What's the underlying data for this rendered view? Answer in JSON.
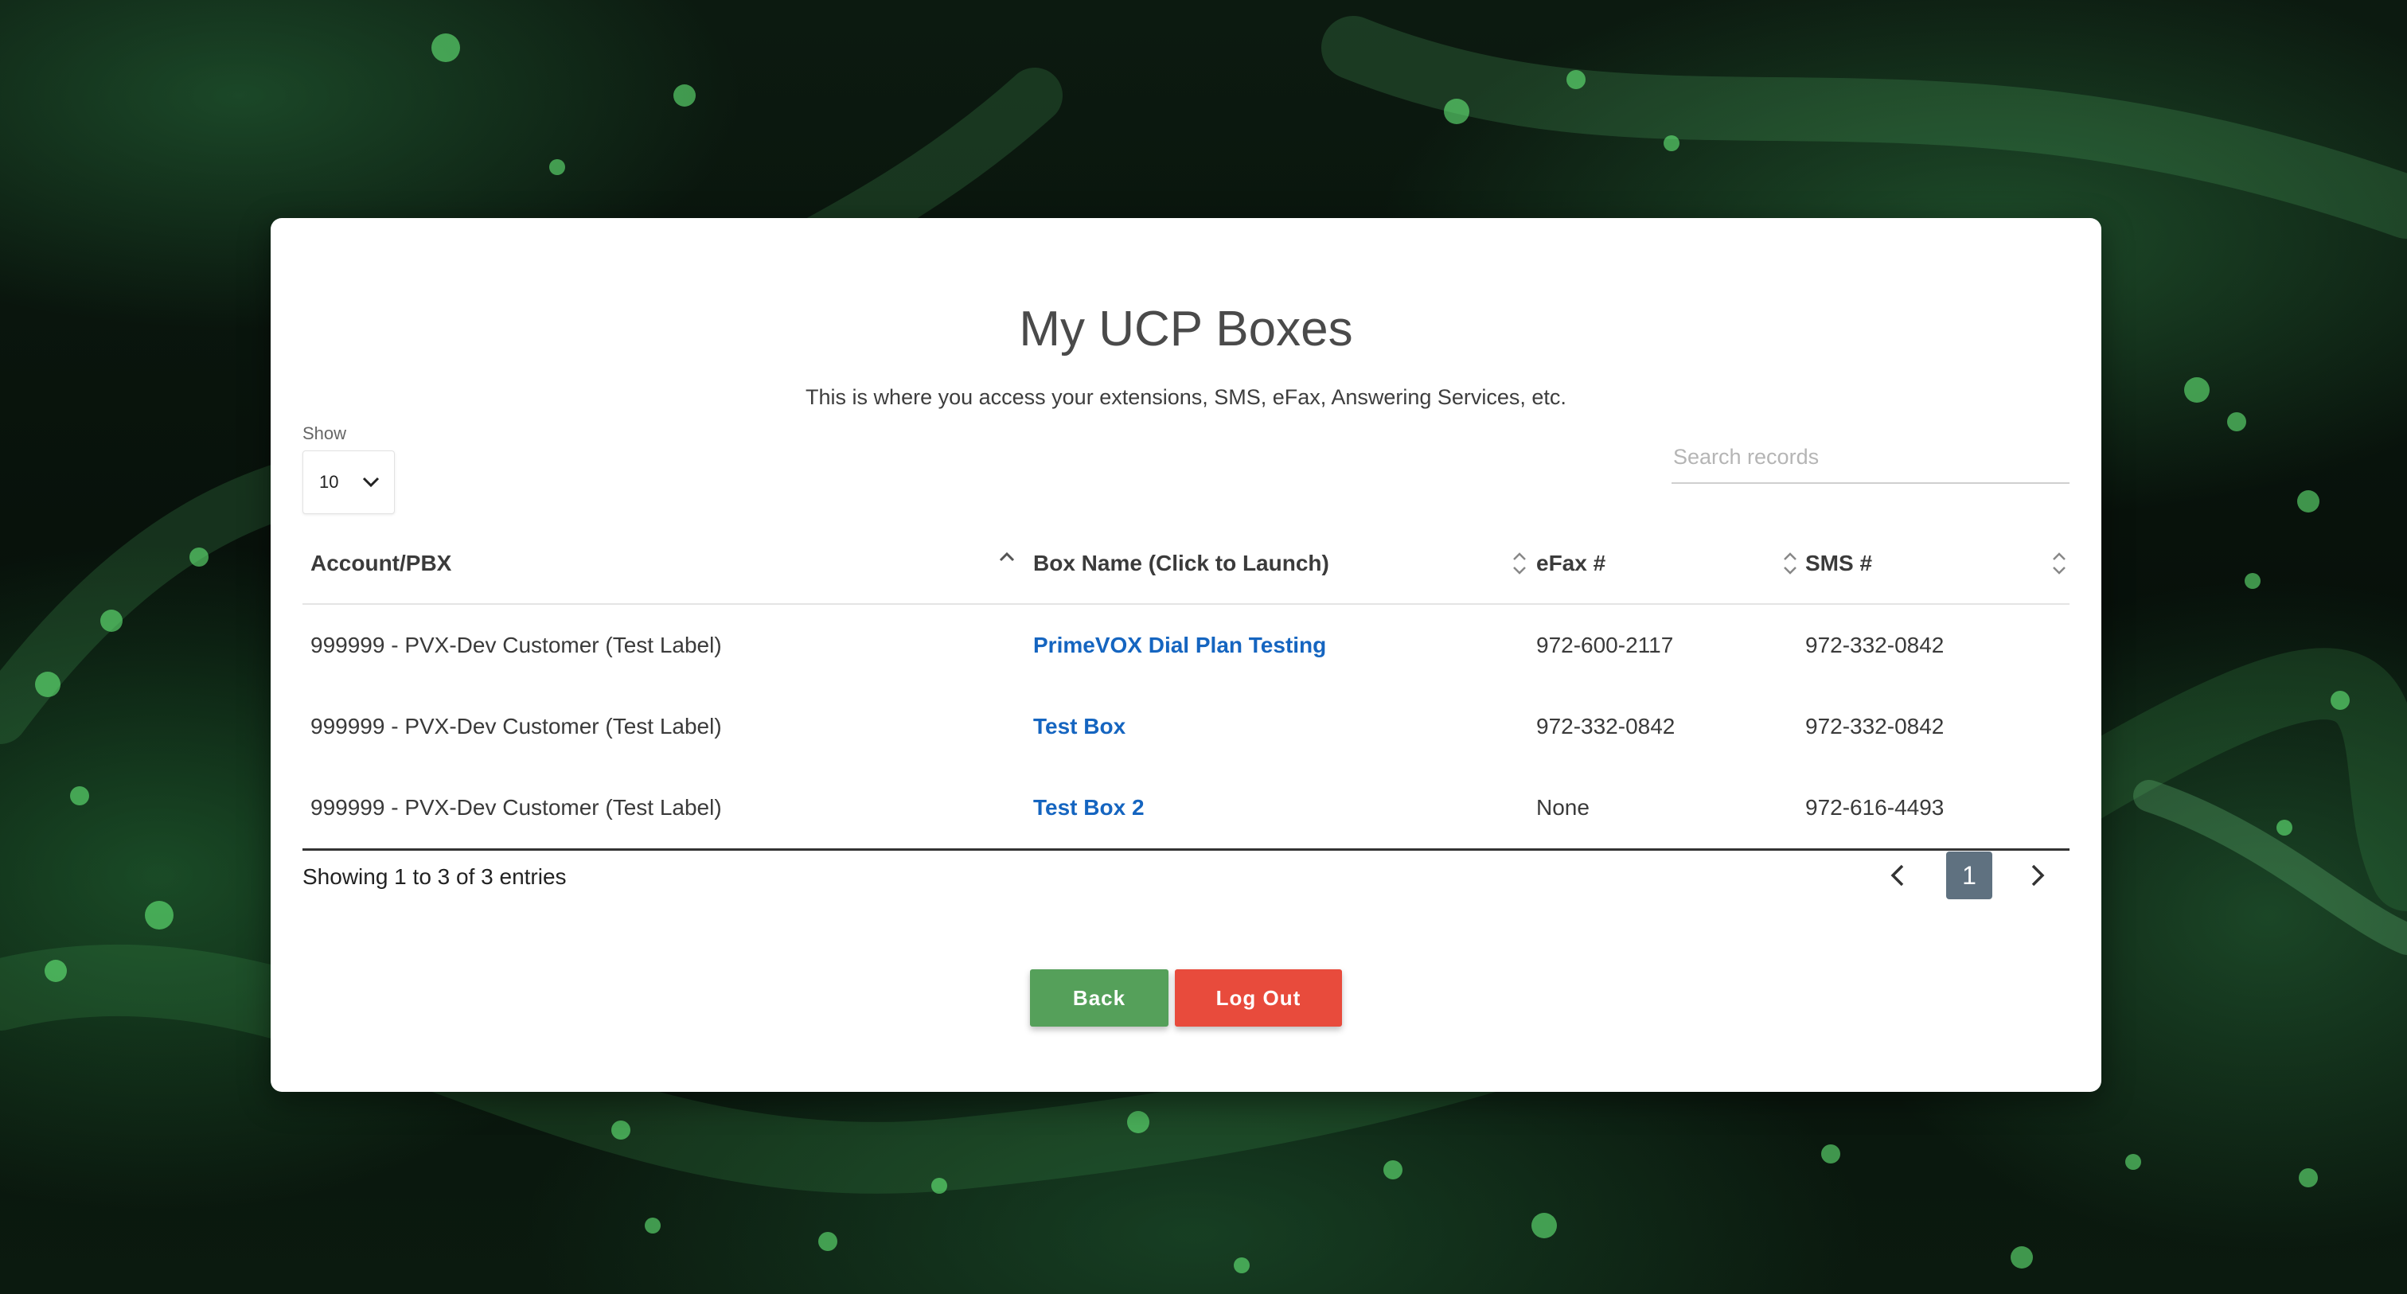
{
  "page": {
    "title": "My UCP Boxes",
    "subtitle": "This is where you access your extensions, SMS, eFax, Answering Services, etc."
  },
  "controls": {
    "show_label": "Show",
    "show_value": "10",
    "search_placeholder": "Search records"
  },
  "table": {
    "columns": [
      "Account/PBX",
      "Box Name (Click to Launch)",
      "eFax #",
      "SMS #"
    ],
    "rows": [
      {
        "account": "999999 - PVX-Dev Customer (Test Label)",
        "box": "PrimeVOX Dial Plan Testing",
        "efax": "972-600-2117",
        "sms": "972-332-0842"
      },
      {
        "account": "999999 - PVX-Dev Customer (Test Label)",
        "box": "Test Box",
        "efax": "972-332-0842",
        "sms": "972-332-0842"
      },
      {
        "account": "999999 - PVX-Dev Customer (Test Label)",
        "box": "Test Box 2",
        "efax": "None",
        "sms": "972-616-4493"
      }
    ],
    "info": "Showing 1 to 3 of 3 entries",
    "current_page": "1"
  },
  "buttons": {
    "back": "Back",
    "logout": "Log Out"
  },
  "colors": {
    "link": "#1565c0",
    "back": "#55a05a",
    "logout": "#e84b3c",
    "page_active": "#5f7180"
  },
  "icons": {
    "sort_asc": "chevron-up-icon",
    "sort_both": "sort-icon",
    "select_caret": "chevron-down-icon",
    "prev": "chevron-left-icon",
    "next": "chevron-right-icon"
  }
}
